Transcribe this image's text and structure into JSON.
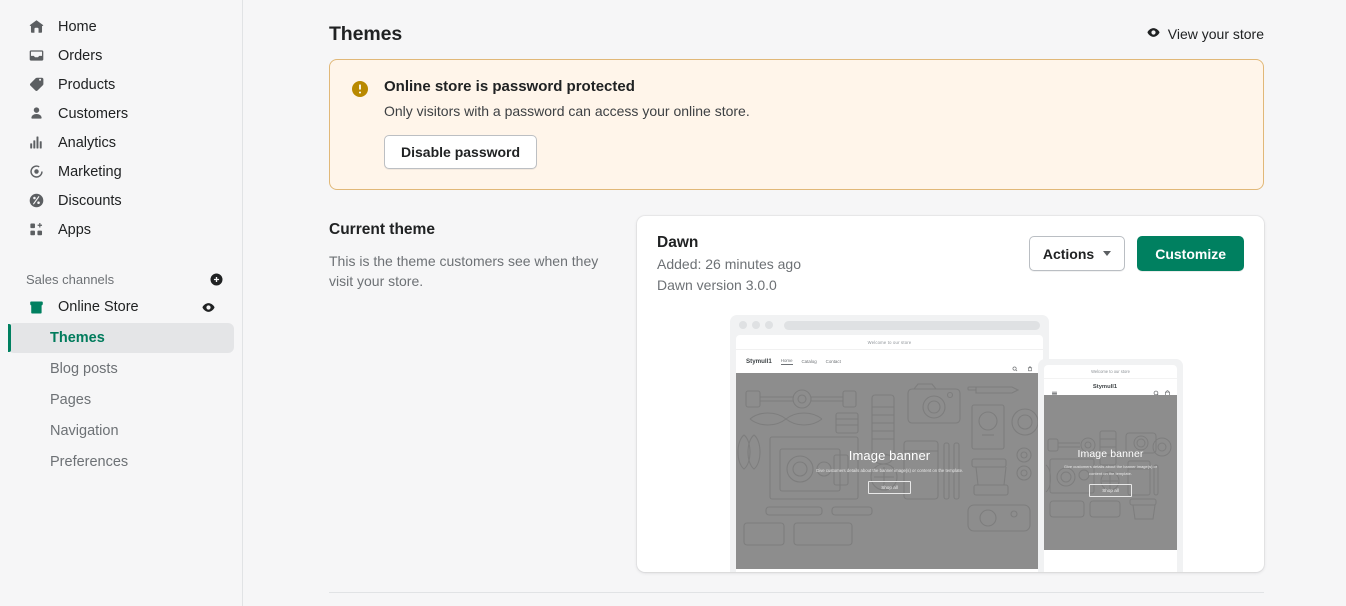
{
  "sidebar": {
    "nav": [
      {
        "label": "Home",
        "icon": "home-icon"
      },
      {
        "label": "Orders",
        "icon": "orders-icon"
      },
      {
        "label": "Products",
        "icon": "products-tag-icon"
      },
      {
        "label": "Customers",
        "icon": "customers-person-icon"
      },
      {
        "label": "Analytics",
        "icon": "analytics-bars-icon"
      },
      {
        "label": "Marketing",
        "icon": "marketing-target-icon"
      },
      {
        "label": "Discounts",
        "icon": "discounts-percent-icon"
      },
      {
        "label": "Apps",
        "icon": "apps-grid-icon"
      }
    ],
    "sales_channels": {
      "label": "Sales channels",
      "add_icon": "plus-circle-icon",
      "channel": {
        "label": "Online Store",
        "icon": "storefront-icon",
        "view_icon": "eye-icon"
      },
      "sub_items": [
        {
          "label": "Themes",
          "active": true
        },
        {
          "label": "Blog posts",
          "active": false
        },
        {
          "label": "Pages",
          "active": false
        },
        {
          "label": "Navigation",
          "active": false
        },
        {
          "label": "Preferences",
          "active": false
        }
      ]
    }
  },
  "header": {
    "title": "Themes",
    "view_store_label": "View your store",
    "view_store_icon": "eye-icon"
  },
  "banner": {
    "icon": "alert-circle-icon",
    "title": "Online store is password protected",
    "body": "Only visitors with a password can access your online store.",
    "action_label": "Disable password"
  },
  "current_theme": {
    "heading": "Current theme",
    "description": "This is the theme customers see when they visit your store.",
    "card": {
      "name": "Dawn",
      "added": "Added: 26 minutes ago",
      "version": "Dawn version 3.0.0",
      "actions_label": "Actions",
      "actions_caret_icon": "chevron-down-icon",
      "customize_label": "Customize"
    },
    "preview": {
      "desktop": {
        "announcement": "Welcome to our store",
        "brand": "Stymull1",
        "nav": [
          "Home",
          "Catalog",
          "Contact"
        ],
        "search_icon": "search-icon",
        "cart_icon": "cart-icon",
        "hero_title": "Image banner",
        "hero_subtitle": "Give customers details about the banner image(s) or content on the template.",
        "hero_button": "Shop all"
      },
      "mobile": {
        "announcement": "Welcome to our store",
        "brand": "Stymull1",
        "menu_icon": "hamburger-icon",
        "search_icon": "search-icon",
        "cart_icon": "cart-icon",
        "hero_title": "Image banner",
        "hero_subtitle": "Give customers details about the banner image(s) or content on the template.",
        "hero_button": "Shop all"
      }
    }
  },
  "colors": {
    "accent_green": "#008060",
    "active_text_green": "#007b5c",
    "banner_bg": "#fff5ea",
    "banner_border": "#e1b878",
    "warning_icon": "#b98900",
    "page_bg": "#f6f6f7",
    "text_primary": "#202223",
    "text_subdued": "#6d7175"
  }
}
